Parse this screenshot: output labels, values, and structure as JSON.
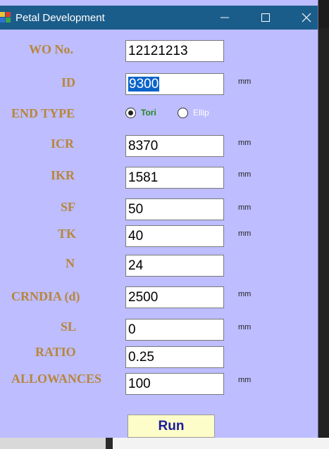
{
  "window": {
    "title": "Petal Development"
  },
  "form": {
    "wo_no": {
      "label": "WO No.",
      "value": "12121213"
    },
    "id": {
      "label": "ID",
      "value": "9300",
      "unit": "mm"
    },
    "end_type": {
      "label": "END TYPE",
      "options": [
        {
          "label": "Tori",
          "selected": true,
          "color": "#1f8a1f"
        },
        {
          "label": "Ellip",
          "selected": false,
          "color": "#ffffff"
        }
      ]
    },
    "icr": {
      "label": "ICR",
      "value": "8370",
      "unit": "mm"
    },
    "ikr": {
      "label": "IKR",
      "value": "1581",
      "unit": "mm"
    },
    "sf": {
      "label": "SF",
      "value": "50",
      "unit": "mm"
    },
    "tk": {
      "label": "TK",
      "value": "40",
      "unit": "mm"
    },
    "n": {
      "label": "N",
      "value": "24"
    },
    "crndia": {
      "label": "CRNDIA (d)",
      "value": "2500",
      "unit": "mm"
    },
    "sl": {
      "label": "SL",
      "value": "0",
      "unit": "mm"
    },
    "ratio": {
      "label": "RATIO",
      "value": "0.25"
    },
    "allowances": {
      "label": "ALLOWANCES",
      "value": "100",
      "unit": "mm"
    }
  },
  "actions": {
    "run_label": "Run"
  },
  "colors": {
    "window_bg": "#bdbdff",
    "titlebar_bg": "#1b5d8a",
    "label_color": "#b8863a",
    "run_bg": "#fdfdc9",
    "run_text": "#1a1a9c"
  },
  "icons": {
    "app": "app-icon",
    "minimize": "minimize-icon",
    "maximize": "maximize-icon",
    "close": "close-icon"
  }
}
